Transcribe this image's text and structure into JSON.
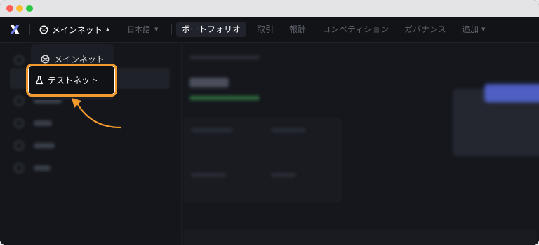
{
  "nav": {
    "network_label": "メインネット",
    "language_label": "日本語",
    "tabs": [
      {
        "label": "ポートフォリオ",
        "active": true
      },
      {
        "label": "取引",
        "active": false
      },
      {
        "label": "報酬",
        "active": false
      },
      {
        "label": "コンペティション",
        "active": false
      },
      {
        "label": "ガバナンス",
        "active": false
      },
      {
        "label": "追加",
        "active": false
      }
    ]
  },
  "network_menu": {
    "items": [
      {
        "label": "メインネット",
        "icon": "globe-icon"
      },
      {
        "label": "テストネット",
        "icon": "flask-icon",
        "highlighted": true
      }
    ]
  },
  "colors": {
    "background": "#15171d",
    "highlight": "#f29a2e",
    "accent": "#5a6ee8"
  }
}
